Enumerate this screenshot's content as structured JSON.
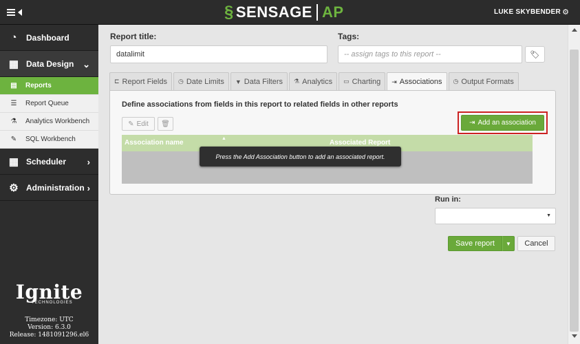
{
  "topbar": {
    "brand_main": "SENSAGE",
    "brand_ap": "AP",
    "user_name": "LUKE SKYBENDER"
  },
  "sidebar": {
    "items": [
      {
        "label": "Dashboard",
        "icon": "dashboard-icon"
      },
      {
        "label": "Data Design",
        "icon": "table-icon"
      },
      {
        "label": "Scheduler",
        "icon": "calendar-icon"
      },
      {
        "label": "Administration",
        "icon": "gears-icon"
      }
    ],
    "sub_items": [
      {
        "label": "Reports",
        "icon": "document-icon",
        "active": true
      },
      {
        "label": "Report Queue",
        "icon": "list-icon"
      },
      {
        "label": "Analytics Workbench",
        "icon": "flask-icon"
      },
      {
        "label": "SQL Workbench",
        "icon": "edit-icon"
      }
    ],
    "logo": "Ignite",
    "logo_sub": "TECHNOLOGIES",
    "timezone": "Timezone: UTC",
    "version": "Version: 6.3.0",
    "release": "Release: 1481091296.el6"
  },
  "form": {
    "title_label": "Report title:",
    "title_value": "datalimit",
    "tags_label": "Tags:",
    "tags_placeholder": "-- assign tags to this report --"
  },
  "tabs": [
    {
      "label": "Report Fields",
      "icon": "fields-icon"
    },
    {
      "label": "Date Limits",
      "icon": "clock-icon"
    },
    {
      "label": "Data Filters",
      "icon": "filter-icon"
    },
    {
      "label": "Analytics",
      "icon": "flask-icon"
    },
    {
      "label": "Charting",
      "icon": "chart-icon"
    },
    {
      "label": "Associations",
      "icon": "associate-icon",
      "active": true
    },
    {
      "label": "Output Formats",
      "icon": "output-icon"
    }
  ],
  "associations": {
    "description": "Define associations from fields in this report to related fields in other reports",
    "edit_label": "Edit",
    "add_label": "Add an association",
    "col_association_name": "Association name",
    "col_associated_report": "Associated Report",
    "empty_message": "Press the Add Association button to add an associated report."
  },
  "run_in": {
    "label": "Run in:",
    "value": ""
  },
  "actions": {
    "save_label": "Save report",
    "cancel_label": "Cancel"
  },
  "colors": {
    "accent_green": "#6aa93a",
    "highlight_red": "#cc2222",
    "topbar_bg": "#2c2c2c"
  }
}
